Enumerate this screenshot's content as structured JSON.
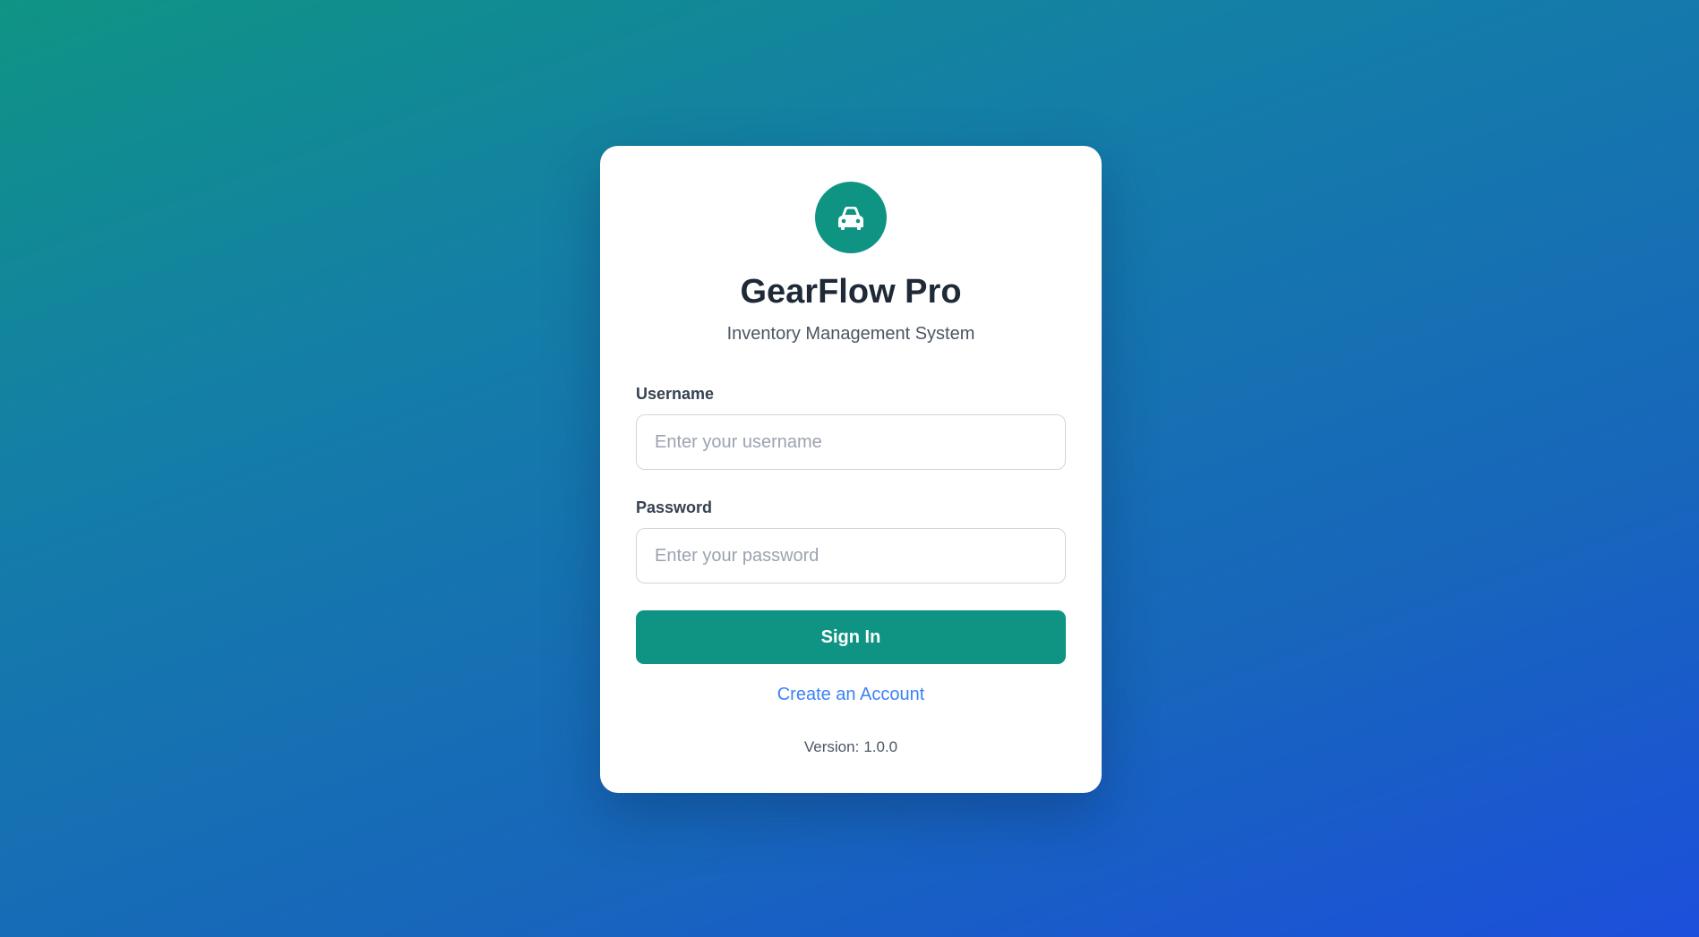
{
  "app": {
    "title": "GearFlow Pro",
    "subtitle": "Inventory Management System",
    "logo_icon": "car-icon"
  },
  "form": {
    "username": {
      "label": "Username",
      "placeholder": "Enter your username",
      "value": ""
    },
    "password": {
      "label": "Password",
      "placeholder": "Enter your password",
      "value": ""
    },
    "submit_label": "Sign In",
    "create_account_label": "Create an Account"
  },
  "footer": {
    "version_label": "Version:",
    "version_value": "1.0.0"
  },
  "colors": {
    "accent": "#0f9484",
    "link": "#3b82f6",
    "background_start": "#0f9484",
    "background_end": "#1c4fdb"
  }
}
